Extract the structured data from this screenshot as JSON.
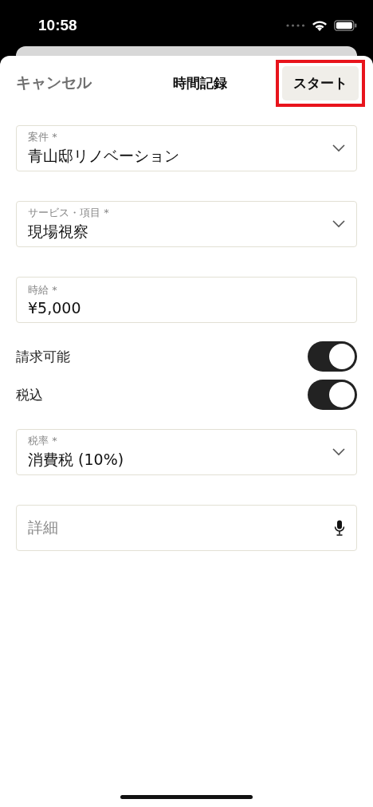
{
  "status_bar": {
    "time": "10:58"
  },
  "header": {
    "cancel": "キャンセル",
    "title": "時間記録",
    "start": "スタート",
    "start_highlighted": true
  },
  "fields": [
    {
      "kind": "select",
      "label": "案件 *",
      "value": "青山邸リノベーション"
    },
    {
      "kind": "select",
      "label": "サービス・項目 *",
      "value": "現場視察"
    },
    {
      "kind": "text",
      "label": "時給 *",
      "value": "¥5,000"
    },
    {
      "kind": "toggle",
      "label": "請求可能",
      "on": true
    },
    {
      "kind": "toggle",
      "label": "税込",
      "on": true
    },
    {
      "kind": "select",
      "label": "税率 *",
      "value": "消費税 (10%)"
    },
    {
      "kind": "dictation",
      "placeholder": "詳細"
    }
  ]
}
